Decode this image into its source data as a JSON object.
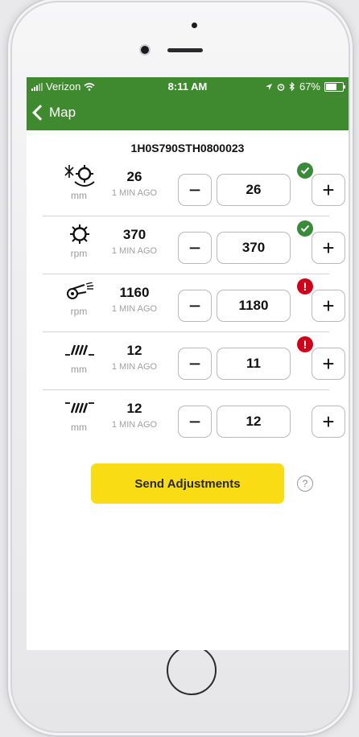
{
  "status_bar": {
    "carrier": "Verizon",
    "time": "8:11 AM",
    "battery": "67%",
    "battery_level": 0.67
  },
  "nav": {
    "back_label": "Map"
  },
  "machine": {
    "id": "1H0S790STH0800023"
  },
  "rows": [
    {
      "icon": "rotor-spacing-icon",
      "unit": "mm",
      "current": "26",
      "ago": "1 MIN AGO",
      "setting": "26",
      "status": "ok"
    },
    {
      "icon": "rotor-speed-icon",
      "unit": "rpm",
      "current": "370",
      "ago": "1 MIN AGO",
      "setting": "370",
      "status": "ok"
    },
    {
      "icon": "fan-speed-icon",
      "unit": "rpm",
      "current": "1160",
      "ago": "1 MIN AGO",
      "setting": "1180",
      "status": "error"
    },
    {
      "icon": "lower-sieve-icon",
      "unit": "mm",
      "current": "12",
      "ago": "1 MIN AGO",
      "setting": "11",
      "status": "error"
    },
    {
      "icon": "upper-sieve-icon",
      "unit": "mm",
      "current": "12",
      "ago": "1 MIN AGO",
      "setting": "12",
      "status": "none"
    }
  ],
  "controls": {
    "minus": "−",
    "plus": "+"
  },
  "actions": {
    "send_label": "Send Adjustments",
    "help_label": "?"
  },
  "colors": {
    "header": "#3f8a2e",
    "send_button": "#fadc14",
    "ok": "#3a8a3c",
    "error": "#d0021b"
  }
}
